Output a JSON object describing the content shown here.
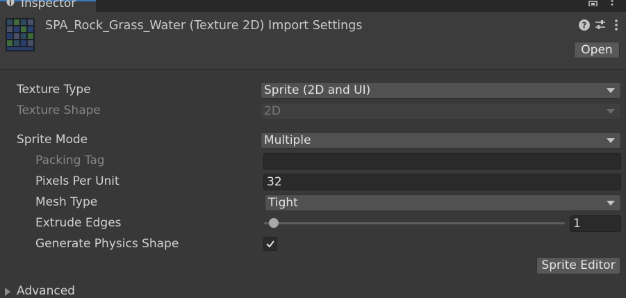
{
  "tab": {
    "title": "Inspector"
  },
  "header": {
    "title": "SPA_Rock_Grass_Water (Texture 2D) Import Settings",
    "open_label": "Open",
    "icons": [
      "help-icon",
      "preset-icon",
      "more-icon"
    ]
  },
  "fields": {
    "texture_type": {
      "label": "Texture Type",
      "value": "Sprite (2D and UI)"
    },
    "texture_shape": {
      "label": "Texture Shape",
      "value": "2D"
    },
    "sprite_mode": {
      "label": "Sprite Mode",
      "value": "Multiple"
    },
    "packing_tag": {
      "label": "Packing Tag",
      "value": ""
    },
    "pixels_per_unit": {
      "label": "Pixels Per Unit",
      "value": "32"
    },
    "mesh_type": {
      "label": "Mesh Type",
      "value": "Tight"
    },
    "extrude_edges": {
      "label": "Extrude Edges",
      "value": "1",
      "slider_min": 0,
      "slider_max": 32
    },
    "generate_physics_shape": {
      "label": "Generate Physics Shape",
      "checked": true
    }
  },
  "sprite_editor_label": "Sprite Editor",
  "advanced_label": "Advanced",
  "colors": {
    "accent": "#3a79bb",
    "panel": "#383838",
    "header": "#3c3c3c"
  }
}
